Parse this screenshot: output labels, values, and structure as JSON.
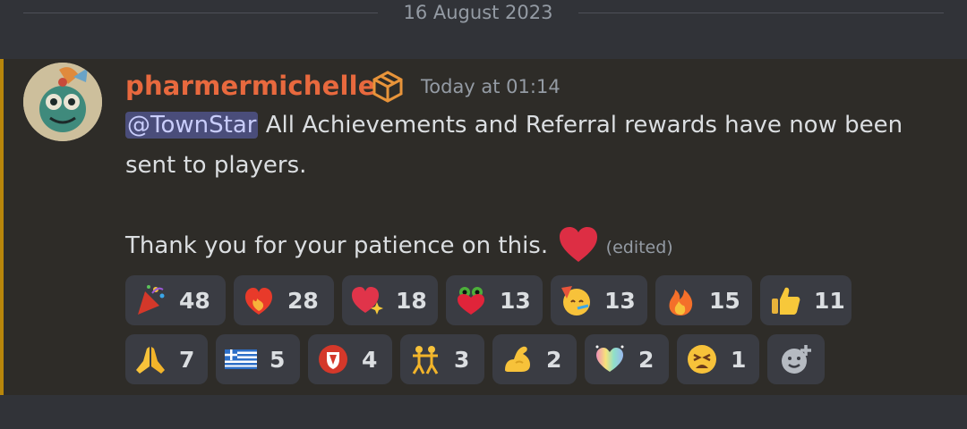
{
  "divider": {
    "date": "16 August 2023"
  },
  "message": {
    "username": "pharmermichelle",
    "timestamp": "Today at 01:14",
    "mention": "@TownStar",
    "text_line1": " All Achievements and Referral rewards have now been sent to players.",
    "text_line2": "Thank you for your patience on this.",
    "edited": "(edited)"
  },
  "reactions": {
    "row1": [
      {
        "emoji": "party-popper-icon",
        "count": "48"
      },
      {
        "emoji": "fire-heart-icon",
        "count": "28"
      },
      {
        "emoji": "sparkling-heart-icon",
        "count": "18"
      },
      {
        "emoji": "frog-heart-icon",
        "count": "13"
      },
      {
        "emoji": "partying-face-icon",
        "count": "13"
      },
      {
        "emoji": "fire-icon",
        "count": "15"
      },
      {
        "emoji": "thumbs-up-icon",
        "count": "11"
      }
    ],
    "row2": [
      {
        "emoji": "folded-hands-icon",
        "count": "7"
      },
      {
        "emoji": "greece-flag-icon",
        "count": "5"
      },
      {
        "emoji": "red-shield-icon",
        "count": "4"
      },
      {
        "emoji": "dancing-people-icon",
        "count": "3"
      },
      {
        "emoji": "flexed-biceps-icon",
        "count": "2"
      },
      {
        "emoji": "rainbow-heart-icon",
        "count": "2"
      },
      {
        "emoji": "tired-face-icon",
        "count": "1"
      }
    ]
  },
  "colors": {
    "background": "#313338",
    "message_highlight": "#2e2c28",
    "mention_bar": "#b8860b",
    "username": "#e8693e",
    "mention_bg": "#4a4d7a",
    "reaction_bg": "#3a3c43"
  }
}
